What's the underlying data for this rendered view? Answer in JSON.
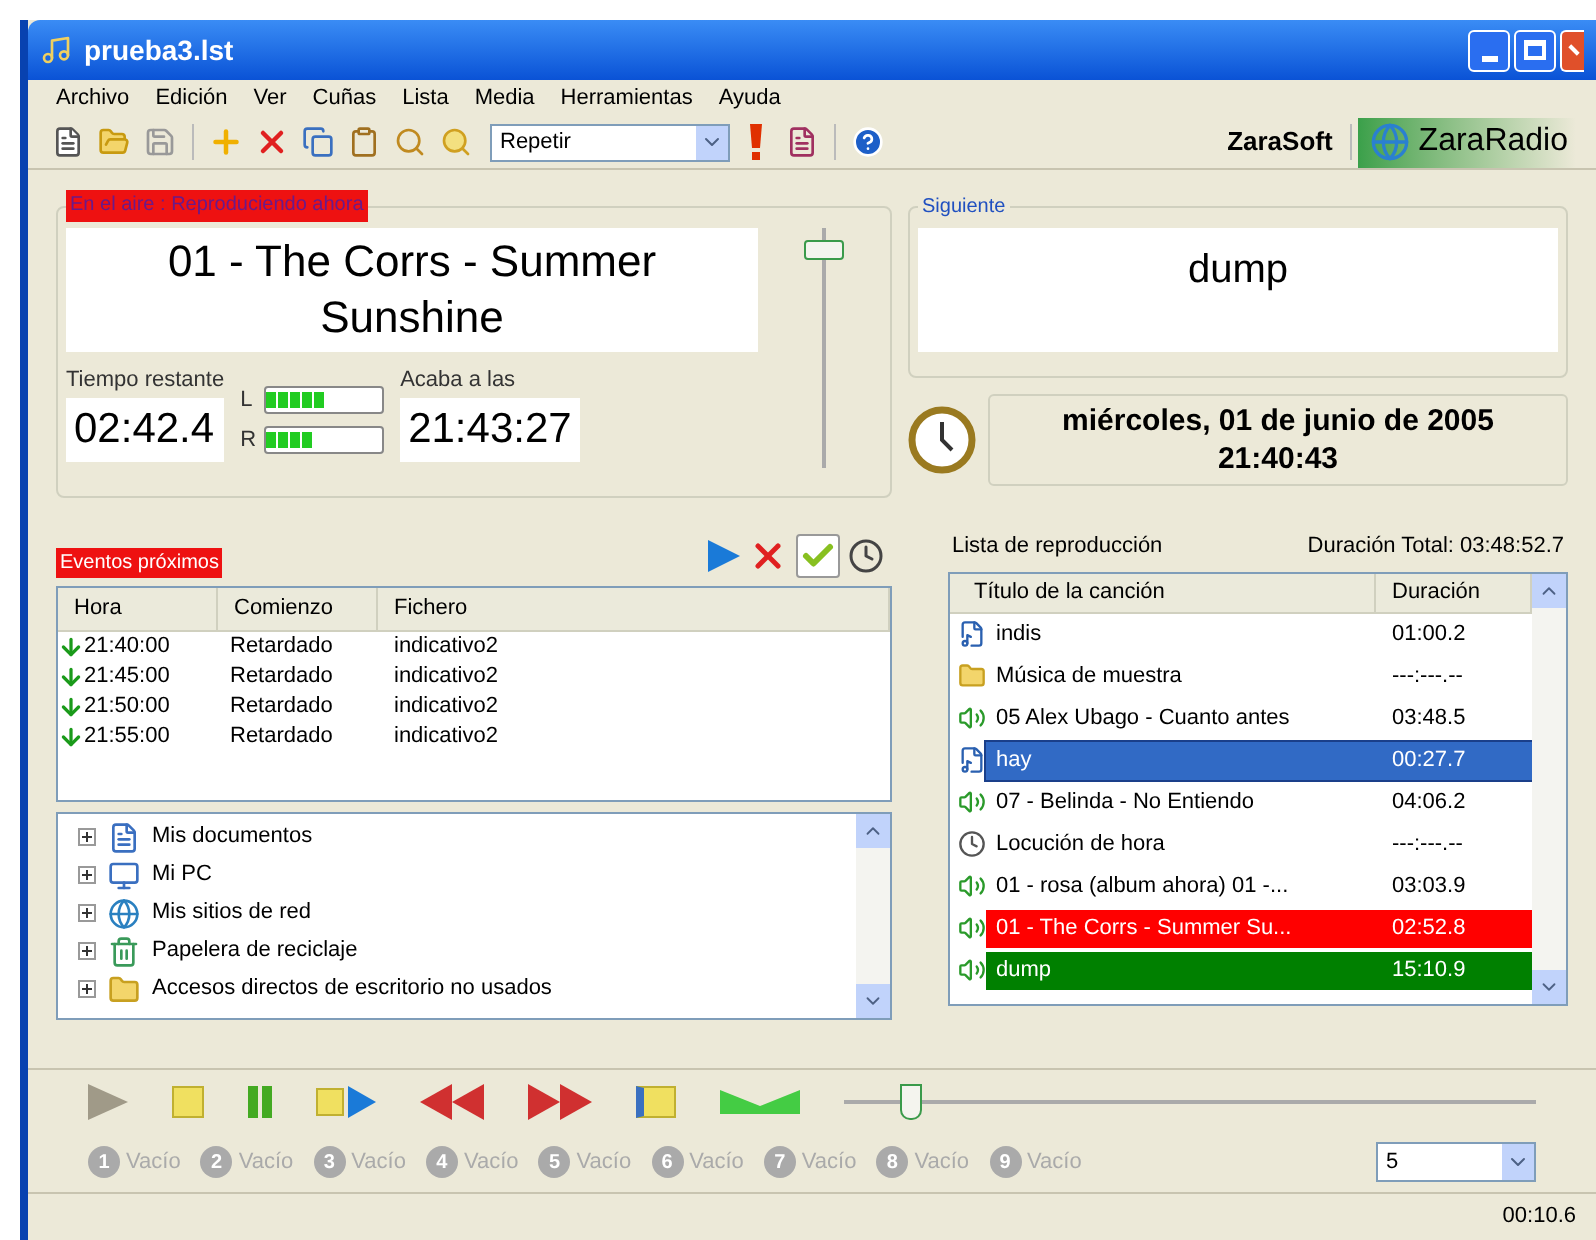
{
  "window": {
    "title": "prueba3.lst"
  },
  "menu": [
    "Archivo",
    "Edición",
    "Ver",
    "Cuñas",
    "Lista",
    "Media",
    "Herramientas",
    "Ayuda"
  ],
  "toolbar": {
    "mode": "Repetir",
    "brand": "ZaraSoft",
    "product": "ZaraRadio"
  },
  "on_air": {
    "label": "En el aire : Reproduciendo ahora",
    "title": "01 - The Corrs - Summer Sunshine",
    "remaining_label": "Tiempo restante",
    "remaining": "02:42.4",
    "ends_label": "Acaba a las",
    "ends": "21:43:27",
    "volume": {
      "level": 0.95
    },
    "meters": [
      {
        "label": "L",
        "level": 0.5
      },
      {
        "label": "R",
        "level": 0.4
      }
    ]
  },
  "next": {
    "label": "Siguiente",
    "title": "dump"
  },
  "clock": {
    "date": "miércoles, 01 de junio de 2005",
    "time": "21:40:43"
  },
  "events": {
    "label": "Eventos próximos",
    "columns": [
      "Hora",
      "Comienzo",
      "Fichero"
    ],
    "rows": [
      [
        "21:40:00",
        "Retardado",
        "indicativo2"
      ],
      [
        "21:45:00",
        "Retardado",
        "indicativo2"
      ],
      [
        "21:50:00",
        "Retardado",
        "indicativo2"
      ],
      [
        "21:55:00",
        "Retardado",
        "indicativo2"
      ]
    ]
  },
  "tree": [
    {
      "label": "Mis documentos",
      "kind": "documents",
      "expanded": false
    },
    {
      "label": "Mi PC",
      "kind": "computer",
      "expanded": false
    },
    {
      "label": "Mis sitios de red",
      "kind": "network",
      "expanded": false
    },
    {
      "label": "Papelera de reciclaje",
      "kind": "recycle",
      "expanded": false
    },
    {
      "label": "Accesos directos de escritorio no usados",
      "kind": "folder",
      "expanded": false
    }
  ],
  "playlist": {
    "label": "Lista de reproducción",
    "total": "Duración Total: 03:48:52.7",
    "columns": [
      "Título de la canción",
      "Duración"
    ],
    "rows": [
      {
        "title": "indis",
        "duration": "01:00.2",
        "kind": "file",
        "selected": false,
        "playing": false,
        "cued": false
      },
      {
        "title": "Música de muestra",
        "duration": "---:---.--",
        "kind": "folder",
        "selected": false,
        "playing": false,
        "cued": false
      },
      {
        "title": "05 Alex Ubago - Cuanto antes",
        "duration": "03:48.5",
        "kind": "audio",
        "selected": false,
        "playing": false,
        "cued": false
      },
      {
        "title": "hay",
        "duration": "00:27.7",
        "kind": "file",
        "selected": true,
        "playing": false,
        "cued": false
      },
      {
        "title": "07 - Belinda - No Entiendo",
        "duration": "04:06.2",
        "kind": "audio",
        "selected": false,
        "playing": false,
        "cued": false
      },
      {
        "title": "Locución de hora",
        "duration": "---:---.--",
        "kind": "clock",
        "selected": false,
        "playing": false,
        "cued": false
      },
      {
        "title": "01 - rosa (album ahora) 01 -...",
        "duration": "03:03.9",
        "kind": "audio",
        "selected": false,
        "playing": false,
        "cued": false
      },
      {
        "title": "01 - The Corrs - Summer Su...",
        "duration": "02:52.8",
        "kind": "audio",
        "selected": false,
        "playing": true,
        "cued": false
      },
      {
        "title": "dump",
        "duration": "15:10.9",
        "kind": "audio",
        "selected": false,
        "playing": false,
        "cued": true
      }
    ]
  },
  "transport": {
    "position": {
      "level": 0.08
    }
  },
  "carts": [
    {
      "number": "1",
      "label": "Vacío"
    },
    {
      "number": "2",
      "label": "Vacío"
    },
    {
      "number": "3",
      "label": "Vacío"
    },
    {
      "number": "4",
      "label": "Vacío"
    },
    {
      "number": "5",
      "label": "Vacío"
    },
    {
      "number": "6",
      "label": "Vacío"
    },
    {
      "number": "7",
      "label": "Vacío"
    },
    {
      "number": "8",
      "label": "Vacío"
    },
    {
      "number": "9",
      "label": "Vacío"
    }
  ],
  "cart_count": "5",
  "status_bar": {
    "time": "00:10.6"
  }
}
